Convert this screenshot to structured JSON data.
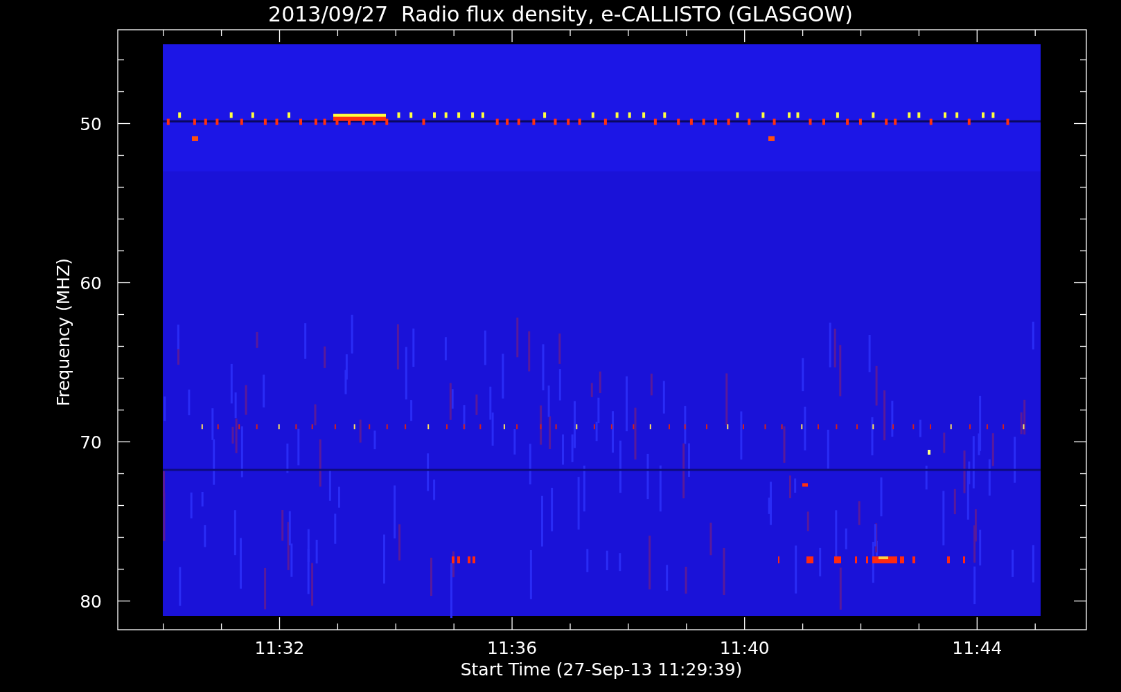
{
  "title": "2013/09/27  Radio flux density, e-CALLISTO (GLASGOW)",
  "plot": {
    "ylabel": "Frequency (MHZ)",
    "xlabel": "Start Time (27-Sep-13 11:29:39)",
    "xticks": [
      "11:32",
      "11:36",
      "11:40",
      "11:44"
    ],
    "yticks": [
      "50",
      "60",
      "70",
      "80"
    ]
  }
}
